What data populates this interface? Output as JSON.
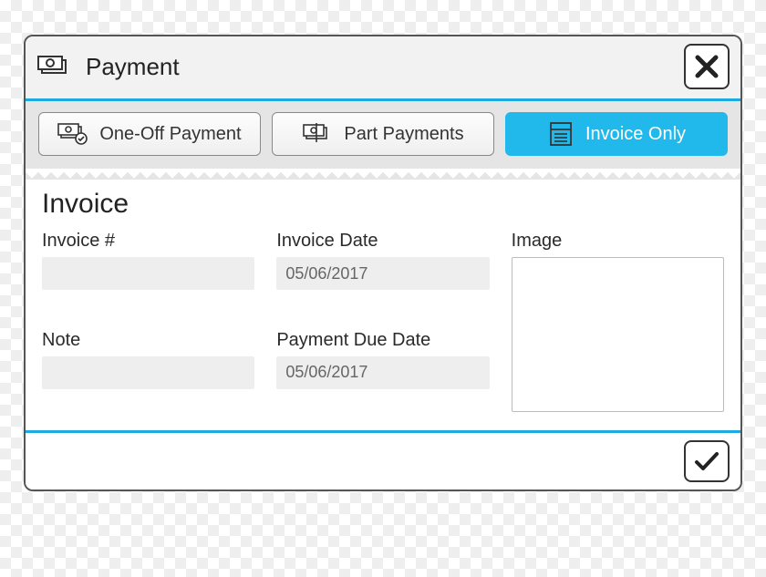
{
  "header": {
    "title": "Payment"
  },
  "tabs": {
    "one_off": "One-Off Payment",
    "part": "Part Payments",
    "invoice_only": "Invoice Only"
  },
  "section": {
    "title": "Invoice"
  },
  "fields": {
    "invoice_number": {
      "label": "Invoice #",
      "value": ""
    },
    "invoice_date": {
      "label": "Invoice Date",
      "value": "05/06/2017"
    },
    "image": {
      "label": "Image"
    },
    "note": {
      "label": "Note",
      "value": ""
    },
    "due_date": {
      "label": "Payment Due Date",
      "value": "05/06/2017"
    }
  },
  "colors": {
    "accent": "#21b8eb"
  }
}
